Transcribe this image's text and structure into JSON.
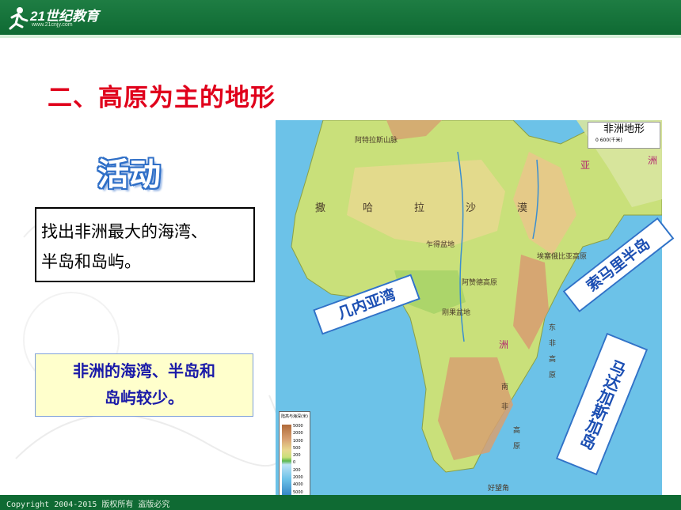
{
  "header": {
    "logo_main": "21世纪教育",
    "logo_sub": "www.21cnjy.com"
  },
  "slide": {
    "title": "二、高原为主的地形",
    "activity_label": "活动",
    "task_text_line1": "找出非洲最大的海湾、",
    "task_text_line2": "半岛和岛屿。",
    "answer_line1": "非洲的海湾、半岛和",
    "answer_line2": "岛屿较少。"
  },
  "map": {
    "title": "非洲地形",
    "scale_label": "0    600(千米)",
    "labels": [
      "阿特拉斯山脉",
      "撒",
      "哈",
      "拉",
      "沙",
      "漠",
      "乍得盆地",
      "阿赞德高原",
      "刚果盆地",
      "南",
      "非",
      "高",
      "原",
      "好望角",
      "埃塞俄比亚高原",
      "东",
      "非",
      "高",
      "原",
      "洲",
      "亚",
      "洲"
    ],
    "legend_title": "陆高与海深(米)",
    "legend_values": [
      "5000",
      "2000",
      "1000",
      "500",
      "200",
      "0",
      "200",
      "2000",
      "4000",
      "5000"
    ],
    "callouts": {
      "gulf": "几内亚湾",
      "peninsula": "索马里半岛",
      "island": "马达加斯加岛"
    },
    "colors": {
      "ocean": "#6cc2e8",
      "land_low": "#c9e07a",
      "land_mid": "#e8d88f",
      "land_high": "#d7a071"
    }
  },
  "footer": {
    "copyright": "Copyright 2004-2015 版权所有 盗版必究"
  }
}
